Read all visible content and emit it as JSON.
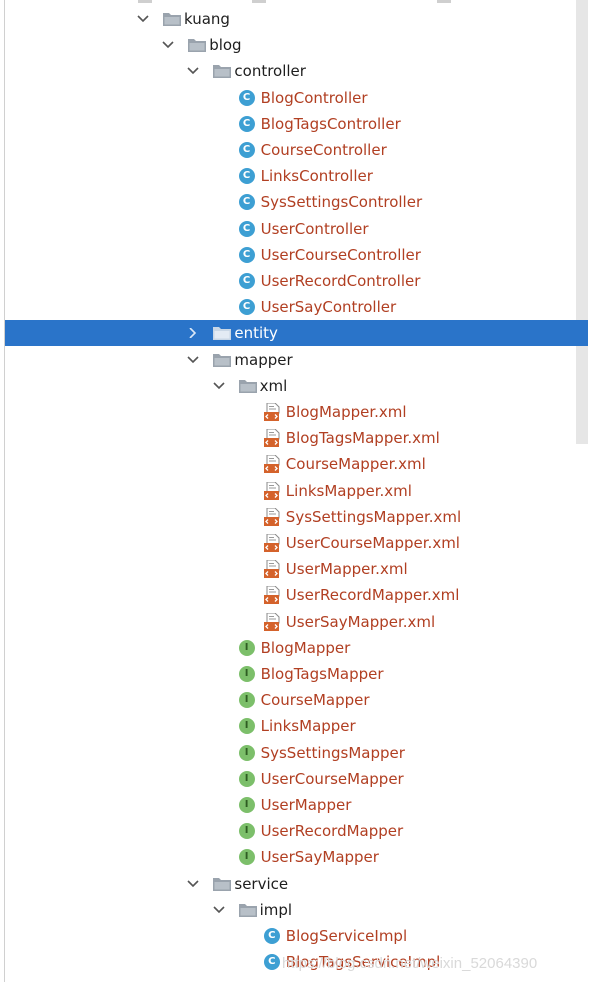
{
  "tree": {
    "rows": [
      {
        "label": "kuang",
        "kind": "dir",
        "indent": 0,
        "expanded": true
      },
      {
        "label": "blog",
        "kind": "dir",
        "indent": 1,
        "expanded": true
      },
      {
        "label": "controller",
        "kind": "dir",
        "indent": 2,
        "expanded": true
      },
      {
        "label": "BlogController",
        "kind": "class",
        "indent": 3
      },
      {
        "label": "BlogTagsController",
        "kind": "class",
        "indent": 3
      },
      {
        "label": "CourseController",
        "kind": "class",
        "indent": 3
      },
      {
        "label": "LinksController",
        "kind": "class",
        "indent": 3
      },
      {
        "label": "SysSettingsController",
        "kind": "class",
        "indent": 3
      },
      {
        "label": "UserController",
        "kind": "class",
        "indent": 3
      },
      {
        "label": "UserCourseController",
        "kind": "class",
        "indent": 3
      },
      {
        "label": "UserRecordController",
        "kind": "class",
        "indent": 3
      },
      {
        "label": "UserSayController",
        "kind": "class",
        "indent": 3
      },
      {
        "label": "entity",
        "kind": "dir",
        "indent": 2,
        "expanded": false,
        "selected": true
      },
      {
        "label": "mapper",
        "kind": "dir",
        "indent": 2,
        "expanded": true
      },
      {
        "label": "xml",
        "kind": "dir",
        "indent": 3,
        "expanded": true
      },
      {
        "label": "BlogMapper.xml",
        "kind": "xml",
        "indent": 4
      },
      {
        "label": "BlogTagsMapper.xml",
        "kind": "xml",
        "indent": 4
      },
      {
        "label": "CourseMapper.xml",
        "kind": "xml",
        "indent": 4
      },
      {
        "label": "LinksMapper.xml",
        "kind": "xml",
        "indent": 4
      },
      {
        "label": "SysSettingsMapper.xml",
        "kind": "xml",
        "indent": 4
      },
      {
        "label": "UserCourseMapper.xml",
        "kind": "xml",
        "indent": 4
      },
      {
        "label": "UserMapper.xml",
        "kind": "xml",
        "indent": 4
      },
      {
        "label": "UserRecordMapper.xml",
        "kind": "xml",
        "indent": 4
      },
      {
        "label": "UserSayMapper.xml",
        "kind": "xml",
        "indent": 4
      },
      {
        "label": "BlogMapper",
        "kind": "interface",
        "indent": 3
      },
      {
        "label": "BlogTagsMapper",
        "kind": "interface",
        "indent": 3
      },
      {
        "label": "CourseMapper",
        "kind": "interface",
        "indent": 3
      },
      {
        "label": "LinksMapper",
        "kind": "interface",
        "indent": 3
      },
      {
        "label": "SysSettingsMapper",
        "kind": "interface",
        "indent": 3
      },
      {
        "label": "UserCourseMapper",
        "kind": "interface",
        "indent": 3
      },
      {
        "label": "UserMapper",
        "kind": "interface",
        "indent": 3
      },
      {
        "label": "UserRecordMapper",
        "kind": "interface",
        "indent": 3
      },
      {
        "label": "UserSayMapper",
        "kind": "interface",
        "indent": 3
      },
      {
        "label": "service",
        "kind": "dir",
        "indent": 2,
        "expanded": true
      },
      {
        "label": "impl",
        "kind": "dir",
        "indent": 3,
        "expanded": true
      },
      {
        "label": "BlogServiceImpl",
        "kind": "class",
        "indent": 4
      },
      {
        "label": "BlogTagsServiceImpl",
        "kind": "class",
        "indent": 4
      }
    ]
  },
  "icons": {
    "class_letter": "C",
    "interface_letter": "I"
  },
  "watermark": "https://blog.csdn.net/weixin_52064390",
  "colors": {
    "selection": "#2a74c9",
    "file_text": "#b13f22",
    "class_icon": "#3d9fd3",
    "interface_icon": "#7cbf6a",
    "xml_icon": "#d4622b"
  }
}
